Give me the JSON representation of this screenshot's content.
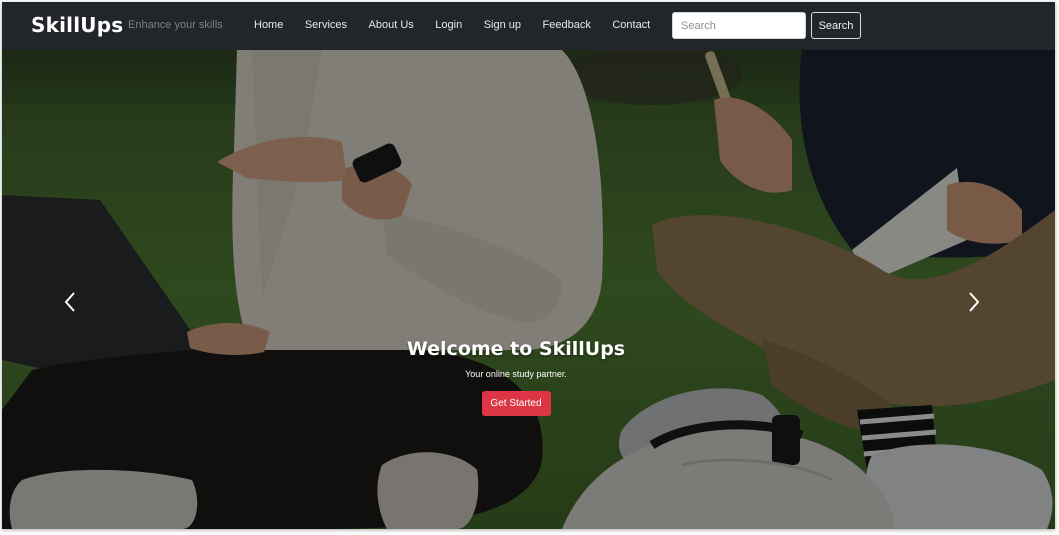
{
  "navbar": {
    "brand": "SkillUps",
    "tagline": "Enhance your skills",
    "links": [
      "Home",
      "Services",
      "About Us",
      "Login",
      "Sign up",
      "Feedback",
      "Contact"
    ],
    "search": {
      "placeholder": "Search",
      "button_label": "Search"
    }
  },
  "hero": {
    "title": "Welcome to SkillUps",
    "subtitle": "Your online study partner.",
    "cta_label": "Get Started",
    "prev_icon": "chevron-left-icon",
    "next_icon": "chevron-right-icon",
    "image_description_icon": "students-on-grass-photo"
  },
  "colors": {
    "navbar_bg": "#22262b",
    "cta_bg": "#dc3545",
    "brand_text": "#ffffff",
    "tagline_text": "#7c8187"
  }
}
